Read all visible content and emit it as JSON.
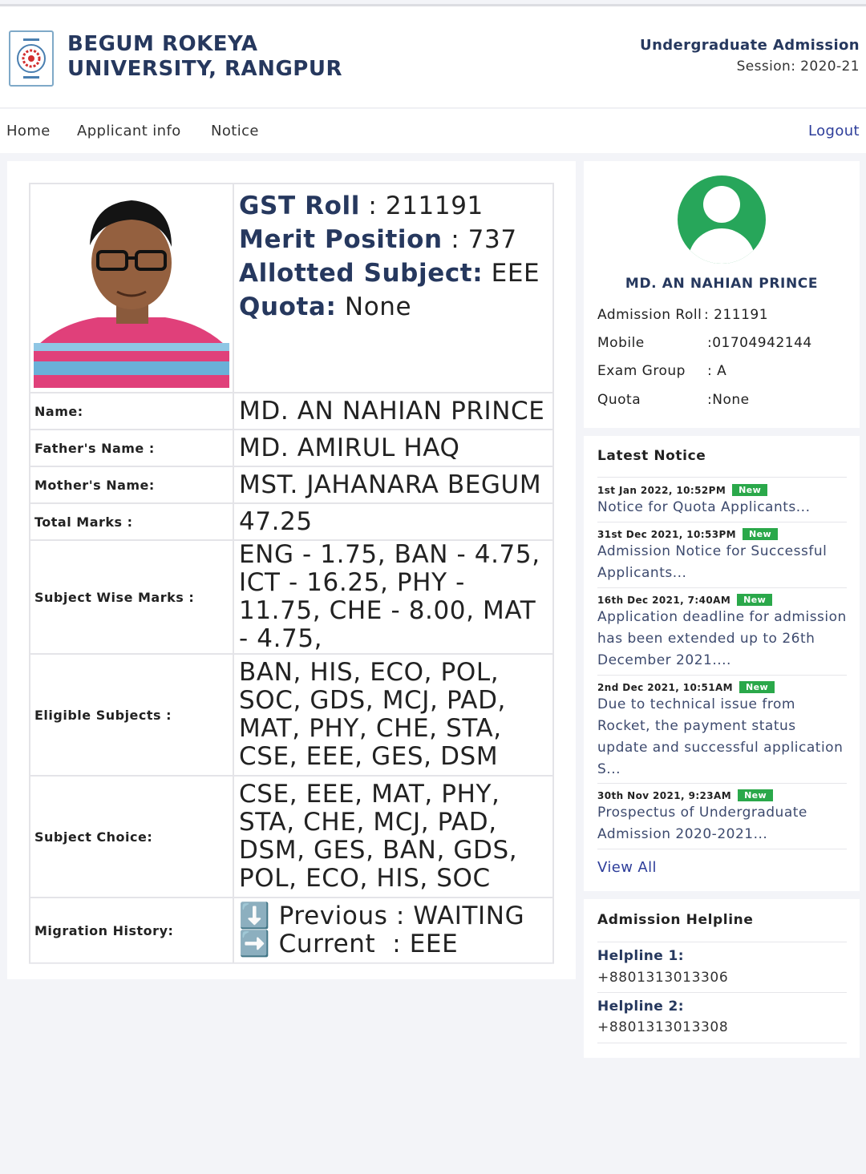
{
  "header": {
    "university_line1": "BEGUM ROKEYA",
    "university_line2": "UNIVERSITY, RANGPUR",
    "admission_title": "Undergraduate Admission",
    "session": "Session: 2020-21",
    "logo_icon": "university-seal-icon"
  },
  "nav": {
    "home": "Home",
    "applicant_info": "Applicant info",
    "notice": "Notice",
    "logout": "Logout"
  },
  "result": {
    "gst_roll_label": "GST Roll",
    "gst_roll_value": ": 211191",
    "merit_label": "Merit Position",
    "merit_value": ": 737",
    "allotted_label": "Allotted Subject:",
    "allotted_value": " EEE",
    "quota_label": "Quota:",
    "quota_value": " None",
    "rows": [
      {
        "label": "Name:",
        "value": "MD. AN NAHIAN PRINCE"
      },
      {
        "label": "Father's Name :",
        "value": "MD. AMIRUL HAQ"
      },
      {
        "label": "Mother's Name:",
        "value": "MST. JAHANARA BEGUM"
      },
      {
        "label": "Total Marks :",
        "value": "47.25"
      },
      {
        "label": "Subject Wise Marks :",
        "value": "ENG - 1.75, BAN - 4.75, ICT - 16.25, PHY - 11.75, CHE - 8.00, MAT - 4.75,"
      },
      {
        "label": "Eligible Subjects :",
        "value": "BAN, HIS, ECO, POL, SOC, GDS, MCJ, PAD, MAT, PHY, CHE, STA, CSE, EEE, GES, DSM"
      },
      {
        "label": "Subject Choice:",
        "value": "CSE, EEE, MAT, PHY, STA, CHE, MCJ, PAD, DSM, GES, BAN, GDS, POL, ECO, HIS, SOC"
      }
    ],
    "migration_label": "Migration History:",
    "migration_previous": "⬇️ Previous : WAITING",
    "migration_current": "➡️ Current  : EEE"
  },
  "profile": {
    "name": "MD. AN NAHIAN PRINCE",
    "fields": [
      {
        "key": "Admission Roll",
        "value": ": 211191"
      },
      {
        "key": "Mobile",
        "value": ":01704942144"
      },
      {
        "key": "Exam Group",
        "value": ": A"
      },
      {
        "key": "Quota",
        "value": ":None"
      }
    ]
  },
  "notices": {
    "title": "Latest Notice",
    "badge": "New",
    "items": [
      {
        "date": "1st Jan 2022, 10:52PM",
        "text": "Notice for Quota Applicants..."
      },
      {
        "date": "31st Dec 2021, 10:53PM",
        "text": "Admission Notice for Successful Applicants..."
      },
      {
        "date": "16th Dec 2021, 7:40AM",
        "text": "Application deadline for admission has been extended up to 26th December 2021...."
      },
      {
        "date": "2nd Dec 2021, 10:51AM",
        "text": "Due to technical issue from Rocket, the payment status update and successful application S..."
      },
      {
        "date": "30th Nov 2021, 9:23AM",
        "text": "Prospectus of Undergraduate Admission 2020-2021..."
      }
    ],
    "view_all": "View All"
  },
  "helpline": {
    "title": "Admission Helpline",
    "items": [
      {
        "label": "Helpline 1:",
        "number": "+8801313013306"
      },
      {
        "label": "Helpline 2:",
        "number": "+8801313013308"
      }
    ]
  },
  "colors": {
    "brand_navy": "#26385e",
    "link_blue": "#2d3d9a",
    "badge_green": "#2aa84a",
    "avatar_green": "#27a65a"
  }
}
